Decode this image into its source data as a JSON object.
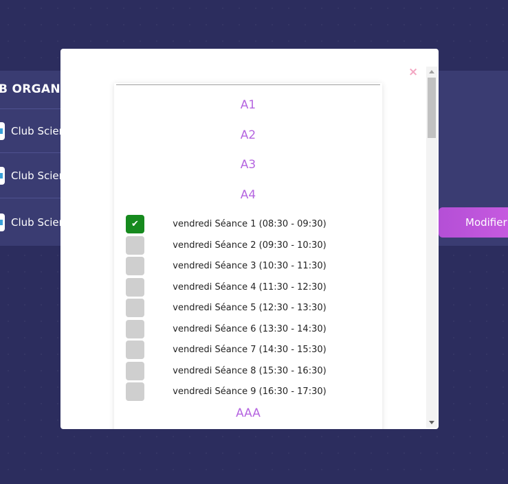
{
  "background": {
    "panel_title": "B ORGANI",
    "club_rows": [
      {
        "label": "Club Scien"
      },
      {
        "label": "Club Scien"
      },
      {
        "label": "Club Scien"
      }
    ],
    "modify_button": "Modifier"
  },
  "modal": {
    "close_symbol": "×",
    "groups_top": [
      "A1",
      "A2",
      "A3",
      "A4"
    ],
    "seances": [
      {
        "label": "vendredi Séance 1 (08:30 - 09:30)",
        "checked": true
      },
      {
        "label": "vendredi Séance 2 (09:30 - 10:30)",
        "checked": false
      },
      {
        "label": "vendredi Séance 3 (10:30 - 11:30)",
        "checked": false
      },
      {
        "label": "vendredi Séance 4 (11:30 - 12:30)",
        "checked": false
      },
      {
        "label": "vendredi Séance 5 (12:30 - 13:30)",
        "checked": false
      },
      {
        "label": "vendredi Séance 6 (13:30 - 14:30)",
        "checked": false
      },
      {
        "label": "vendredi Séance 7 (14:30 - 15:30)",
        "checked": false
      },
      {
        "label": "vendredi Séance 8 (15:30 - 16:30)",
        "checked": false
      },
      {
        "label": "vendredi Séance 9 (16:30 - 17:30)",
        "checked": false
      }
    ],
    "groups_bottom": [
      "AAA"
    ],
    "check_glyph": "✔"
  },
  "colors": {
    "accent": "#b565e0",
    "checked": "#168a1e",
    "unchecked": "#cfcfcf",
    "background": "#2c2d5e"
  }
}
